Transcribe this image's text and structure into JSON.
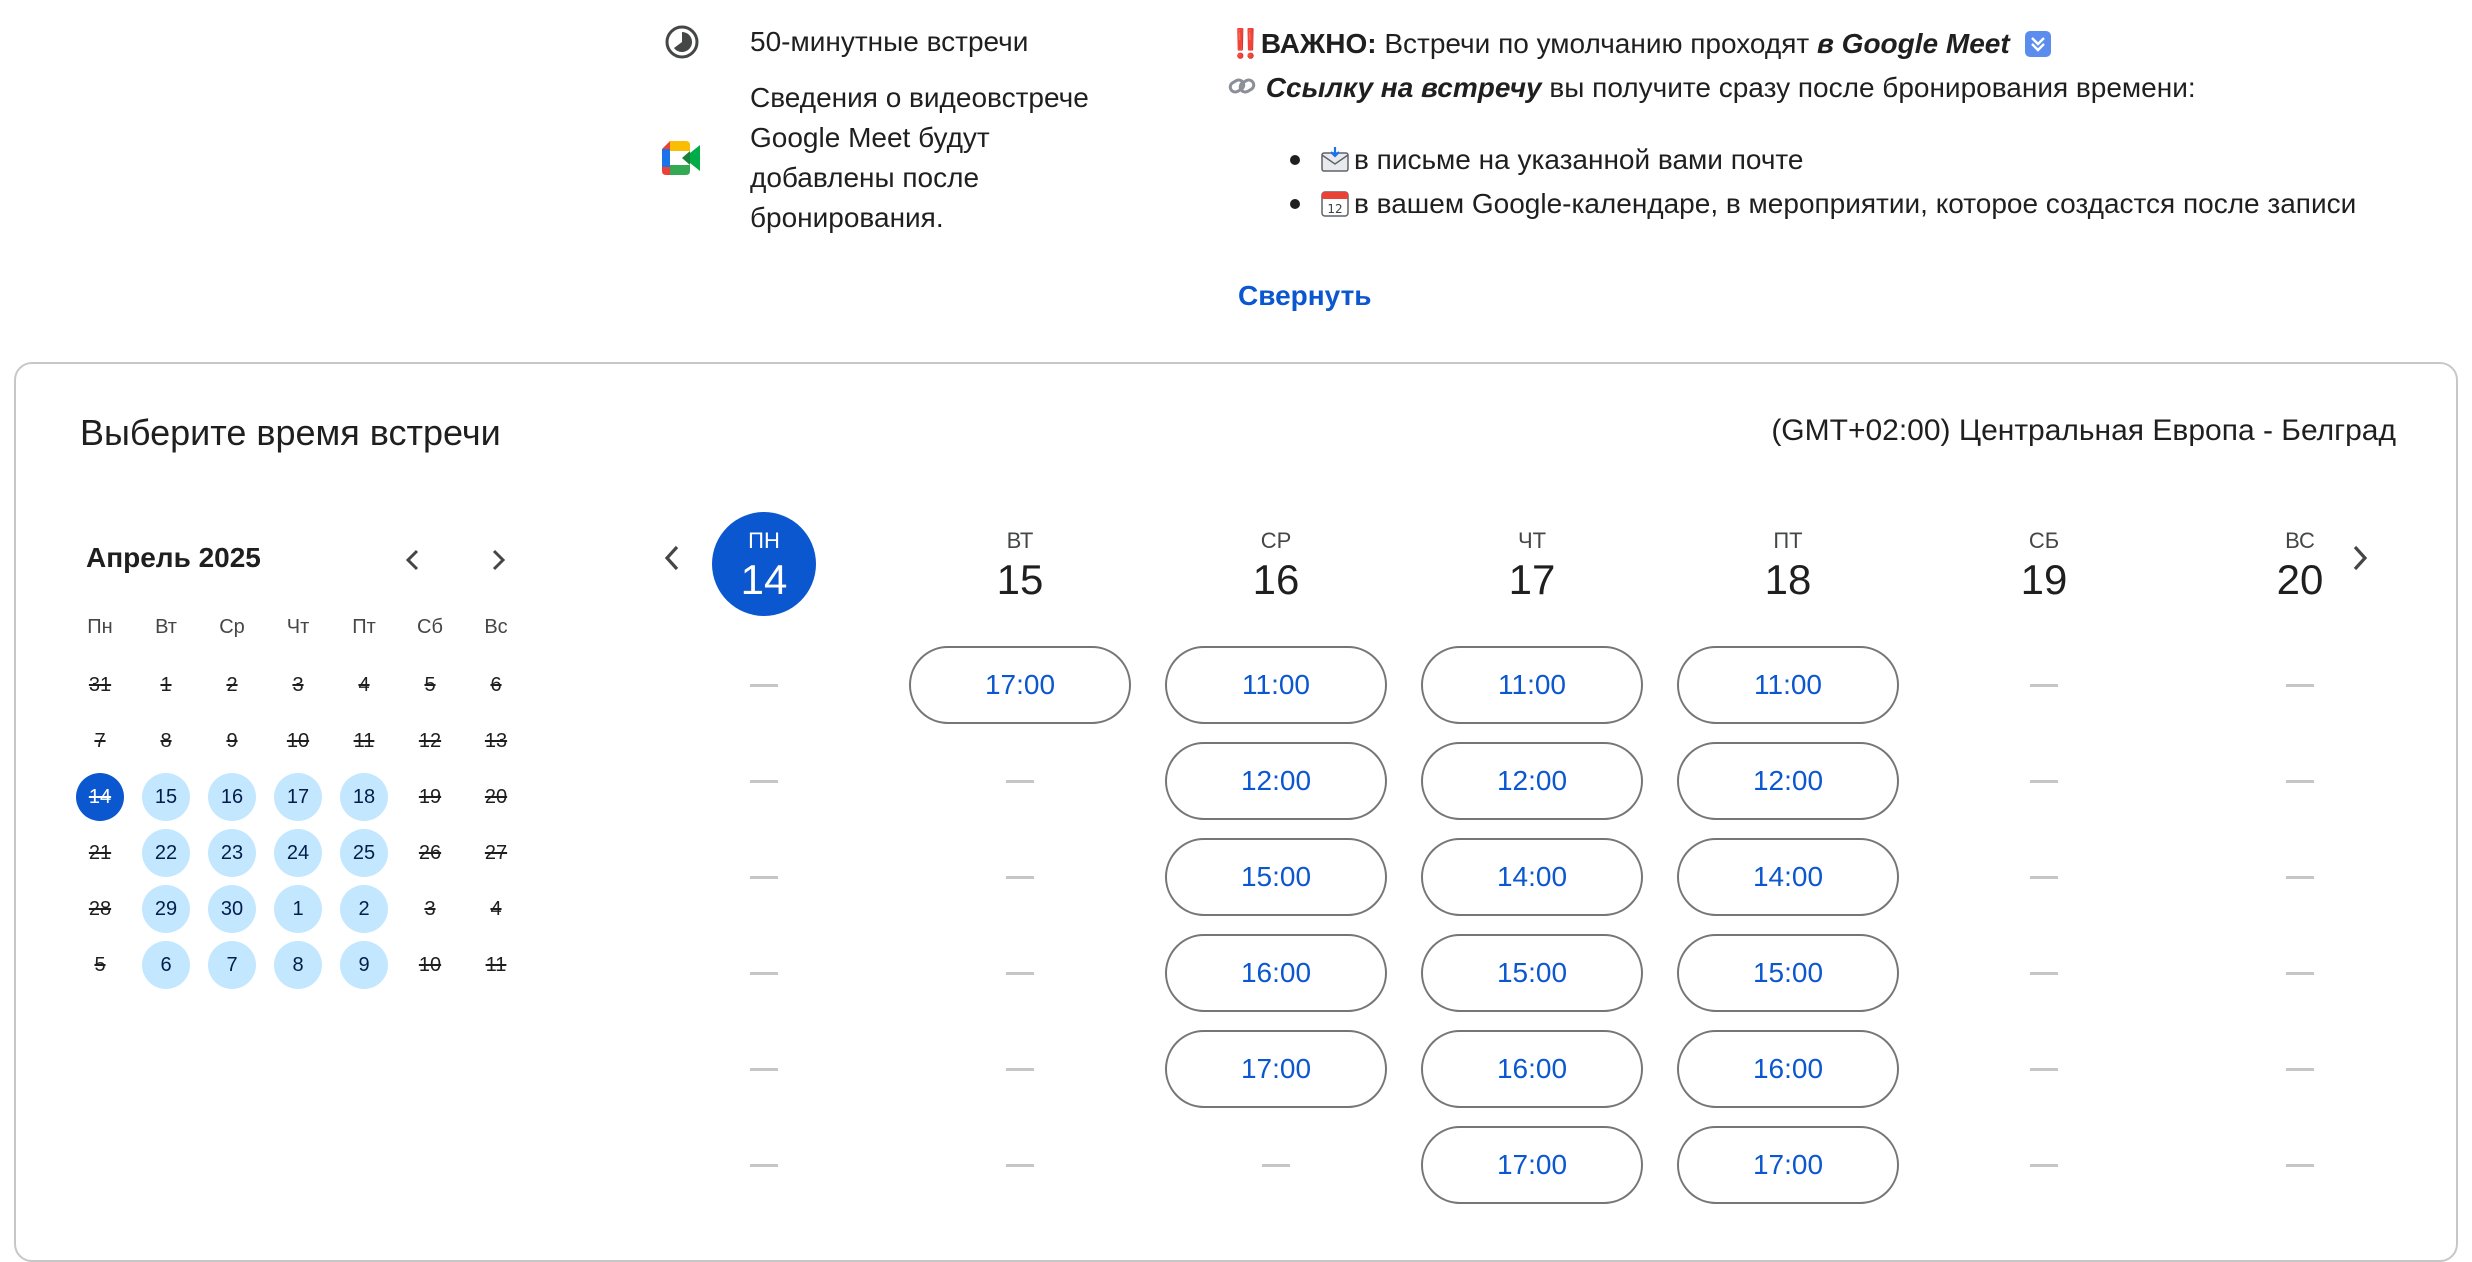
{
  "info": {
    "duration_text": "50-минутные встречи",
    "meet_text_lines": [
      "Сведения о видеовстрече",
      "Google Meet будут",
      "добавлены после",
      "бронирования."
    ]
  },
  "description": {
    "important_marks": "‼️",
    "important_label": "ВАЖНО:",
    "important_text": "Встречи по умолчанию проходят",
    "important_emph": "в Google Meet",
    "link_emoji": "🔗",
    "link_emph": "Ссылку на встречу",
    "link_text": "вы получите сразу после бронирования времени:",
    "bullets": [
      {
        "emoji": "📩",
        "text": "в письме на указанной вами почте"
      },
      {
        "emoji": "📆",
        "text": "в вашем Google-календаре, в мероприятии, которое создастся после записи"
      }
    ],
    "collapse_label": "Свернуть"
  },
  "booking": {
    "title": "Выберите время встречи",
    "timezone": "(GMT+02:00) Центральная Европа - Белград"
  },
  "mini_calendar": {
    "month_label": "Апрель 2025",
    "weekdays": [
      "Пн",
      "Вт",
      "Ср",
      "Чт",
      "Пт",
      "Сб",
      "Вс"
    ],
    "weeks": [
      [
        {
          "d": "31",
          "s": "disabled"
        },
        {
          "d": "1",
          "s": "disabled"
        },
        {
          "d": "2",
          "s": "disabled"
        },
        {
          "d": "3",
          "s": "disabled"
        },
        {
          "d": "4",
          "s": "disabled"
        },
        {
          "d": "5",
          "s": "disabled"
        },
        {
          "d": "6",
          "s": "disabled"
        }
      ],
      [
        {
          "d": "7",
          "s": "disabled"
        },
        {
          "d": "8",
          "s": "disabled"
        },
        {
          "d": "9",
          "s": "disabled"
        },
        {
          "d": "10",
          "s": "disabled"
        },
        {
          "d": "11",
          "s": "disabled"
        },
        {
          "d": "12",
          "s": "disabled"
        },
        {
          "d": "13",
          "s": "disabled"
        }
      ],
      [
        {
          "d": "14",
          "s": "selected"
        },
        {
          "d": "15",
          "s": "avail"
        },
        {
          "d": "16",
          "s": "avail"
        },
        {
          "d": "17",
          "s": "avail"
        },
        {
          "d": "18",
          "s": "avail"
        },
        {
          "d": "19",
          "s": "disabled"
        },
        {
          "d": "20",
          "s": "disabled"
        }
      ],
      [
        {
          "d": "21",
          "s": "disabled"
        },
        {
          "d": "22",
          "s": "avail"
        },
        {
          "d": "23",
          "s": "avail"
        },
        {
          "d": "24",
          "s": "avail"
        },
        {
          "d": "25",
          "s": "avail"
        },
        {
          "d": "26",
          "s": "disabled"
        },
        {
          "d": "27",
          "s": "disabled"
        }
      ],
      [
        {
          "d": "28",
          "s": "disabled"
        },
        {
          "d": "29",
          "s": "avail"
        },
        {
          "d": "30",
          "s": "avail"
        },
        {
          "d": "1",
          "s": "avail"
        },
        {
          "d": "2",
          "s": "avail"
        },
        {
          "d": "3",
          "s": "disabled"
        },
        {
          "d": "4",
          "s": "disabled"
        }
      ],
      [
        {
          "d": "5",
          "s": "disabled"
        },
        {
          "d": "6",
          "s": "avail"
        },
        {
          "d": "7",
          "s": "avail"
        },
        {
          "d": "8",
          "s": "avail"
        },
        {
          "d": "9",
          "s": "avail"
        },
        {
          "d": "10",
          "s": "disabled"
        },
        {
          "d": "11",
          "s": "disabled"
        }
      ]
    ]
  },
  "week": {
    "days": [
      {
        "dow": "ПН",
        "num": "14",
        "selected": true,
        "slots": [
          null,
          null,
          null,
          null,
          null,
          null
        ]
      },
      {
        "dow": "ВТ",
        "num": "15",
        "selected": false,
        "slots": [
          "17:00",
          null,
          null,
          null,
          null,
          null
        ]
      },
      {
        "dow": "СР",
        "num": "16",
        "selected": false,
        "slots": [
          "11:00",
          "12:00",
          "15:00",
          "16:00",
          "17:00",
          null
        ]
      },
      {
        "dow": "ЧТ",
        "num": "17",
        "selected": false,
        "slots": [
          "11:00",
          "12:00",
          "14:00",
          "15:00",
          "16:00",
          "17:00"
        ]
      },
      {
        "dow": "ПТ",
        "num": "18",
        "selected": false,
        "slots": [
          "11:00",
          "12:00",
          "14:00",
          "15:00",
          "16:00",
          "17:00"
        ]
      },
      {
        "dow": "СБ",
        "num": "19",
        "selected": false,
        "slots": [
          null,
          null,
          null,
          null,
          null,
          null
        ]
      },
      {
        "dow": "ВС",
        "num": "20",
        "selected": false,
        "slots": [
          null,
          null,
          null,
          null,
          null,
          null
        ]
      }
    ]
  },
  "colors": {
    "accent": "#0b57d0",
    "available_day": "#c2e7ff",
    "slot_border": "#747775",
    "card_border": "#c7c7c7",
    "important_marks": "#d93025"
  }
}
